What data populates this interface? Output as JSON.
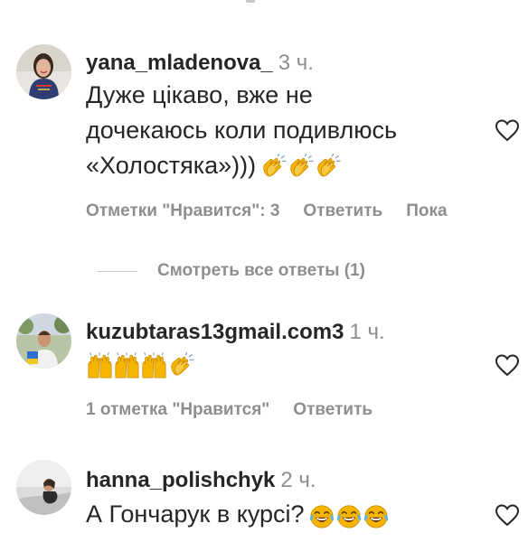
{
  "comments": [
    {
      "username": "yana_mladenova_",
      "time": "3 ч.",
      "text_lines": [
        "Дуже цікаво, вже не",
        "дочекаюсь коли подивлюсь",
        "«Холостяка»)))"
      ],
      "emoji": [
        "clapping-hands",
        "clapping-hands",
        "clapping-hands"
      ],
      "likes_label": "Отметки \"Нравится\": 3",
      "reply_label": "Ответить",
      "translate_label": "Пока"
    },
    {
      "username": "kuzubtaras13gmail.com3",
      "time": "1 ч.",
      "emoji": [
        "raising-hands",
        "raising-hands",
        "raising-hands",
        "clapping-hands"
      ],
      "likes_label": "1 отметка \"Нравится\"",
      "reply_label": "Ответить"
    },
    {
      "username": "hanna_polishchyk",
      "time": "2 ч.",
      "text": "А Гончарук в курсі?",
      "emoji": [
        "tears-of-joy",
        "tears-of-joy",
        "tears-of-joy"
      ]
    }
  ],
  "view_replies_label": "Смотреть все ответы (1)",
  "colors": {
    "text": "#262626",
    "secondary": "#8e8e8e",
    "divider": "#c7c7c7",
    "emoji": "#f4b400"
  }
}
